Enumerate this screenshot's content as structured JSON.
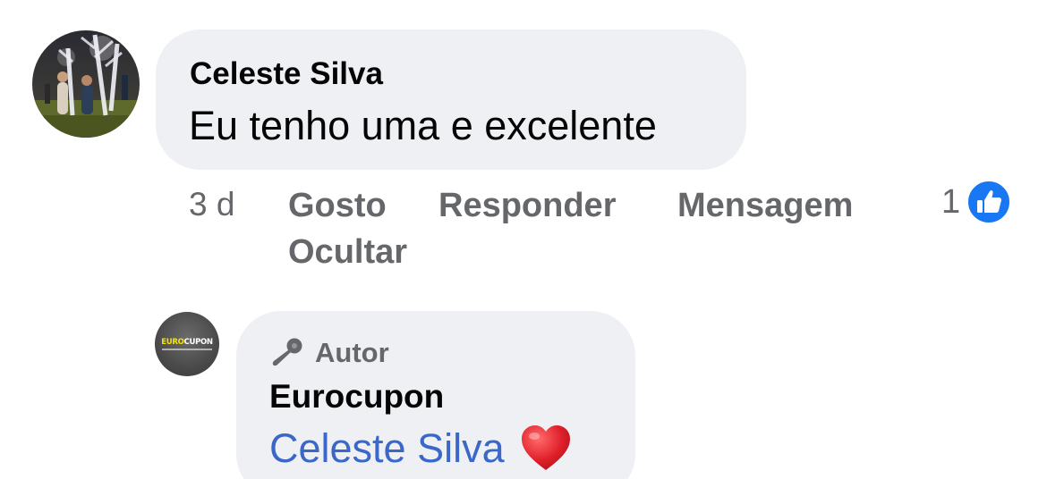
{
  "comment": {
    "author": "Celeste Silva",
    "text": "Eu tenho uma e excelente",
    "time": "3 d",
    "actions": {
      "like": "Gosto",
      "reply": "Responder",
      "message": "Mensagem",
      "hide": "Ocultar"
    },
    "reactions": {
      "count": "1",
      "icon": "like-icon",
      "color": "#1877f2"
    }
  },
  "reply": {
    "badge": "Autor",
    "badge_icon": "microphone-icon",
    "author": "Eurocupon",
    "mention": "Celeste Silva",
    "emoji": "heart-icon",
    "avatar_logo": {
      "part1": "EURO",
      "part2": "CUPON"
    }
  },
  "colors": {
    "bubble": "#eff0f4",
    "secondary_text": "#65676b",
    "mention": "#3a67c8",
    "heart": "#e0202a"
  }
}
